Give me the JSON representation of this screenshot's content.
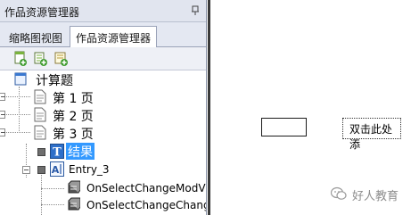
{
  "panel": {
    "title": "作品资源管理器",
    "tabs": [
      {
        "label": "缩略图视图"
      },
      {
        "label": "作品资源管理器"
      }
    ]
  },
  "toolbar": {
    "buttons": [
      {
        "icon": "add-page-icon"
      },
      {
        "icon": "add-group-icon"
      },
      {
        "icon": "add-item-icon"
      }
    ]
  },
  "tree": {
    "root": "计算题",
    "pages": [
      "第 1 页",
      "第 2 页",
      "第 3 页"
    ],
    "result": "结果",
    "entry": "Entry_3",
    "events": [
      "OnSelectChangeModV",
      "OnSelectChangeChang"
    ]
  },
  "canvas": {
    "button_text": "双击此处添"
  },
  "watermark": {
    "text": "好人教育"
  },
  "colors": {
    "panel_bg": "#d6dbe9",
    "selection": "#3399ff",
    "canvas_border": "#3a3a3a"
  }
}
